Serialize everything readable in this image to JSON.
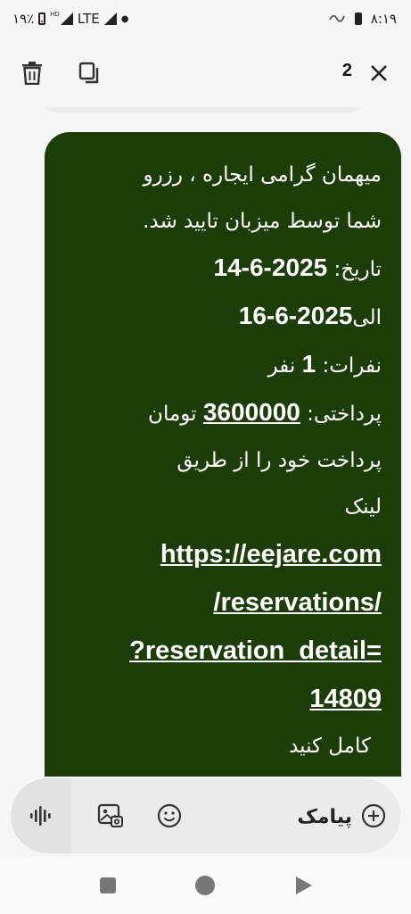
{
  "status_bar": {
    "battery": "۱۹٪",
    "network": "LTE",
    "hd_badge": "HD",
    "time": "۸:۱۹"
  },
  "top_bar": {
    "selected_count": "2"
  },
  "message": {
    "line1": "میهمان گرامی ایجاره ، رزرو",
    "line2": "شما توسط میزبان تایید شد.",
    "date_label": "تاریخ: ",
    "date_from": "14-6-2025",
    "to_label": "الی",
    "date_to": "16-6-2025",
    "guests_label": "نفرات: ",
    "guests_count": "1",
    "guests_unit": " نفر",
    "payment_label": "پرداختی: ",
    "amount": "3600000",
    "currency": " تومان",
    "pay_line": "پرداخت خود را از طریق",
    "link_label": "لینک",
    "link_line1": "https://eejare.com",
    "link_line2": "/reservations/",
    "link_line3": "?reservation_detail=",
    "link_line4": "14809",
    "complete": "کامل کنید"
  },
  "compose": {
    "placeholder": "پیامک"
  },
  "colors": {
    "bubble": "#1c3d08",
    "background": "#f6f6f6"
  }
}
